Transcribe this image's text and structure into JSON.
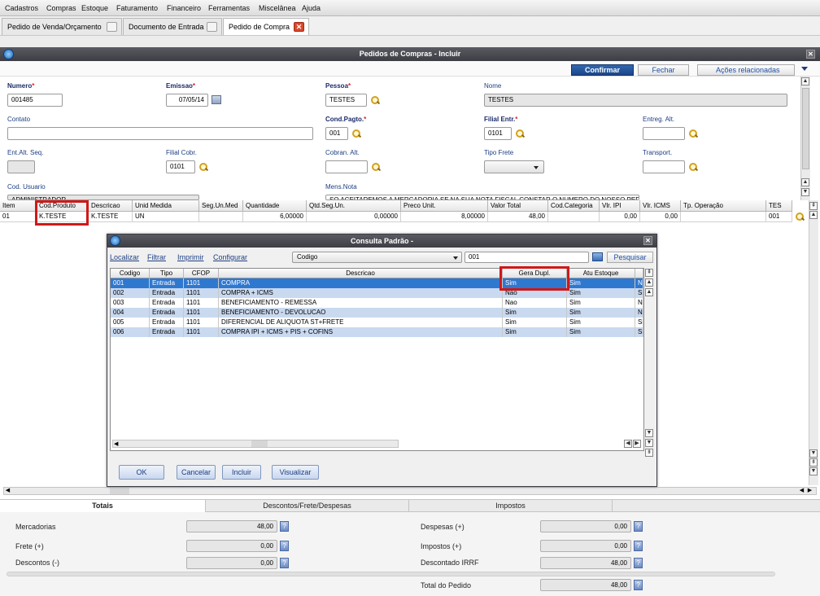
{
  "menu": [
    "Cadastros",
    "Compras",
    "Estoque",
    "Faturamento",
    "Financeiro",
    "Ferramentas",
    "Miscelânea",
    "Ajuda"
  ],
  "tabs": [
    {
      "label": "Pedido de Venda/Orçamento"
    },
    {
      "label": "Documento de Entrada"
    },
    {
      "label": "Pedido de Compra"
    }
  ],
  "window": {
    "title": "Pedidos de Compras - Incluir"
  },
  "toolbar": {
    "confirm": "Confirmar",
    "close": "Fechar",
    "actions": "Ações relacionadas"
  },
  "form": {
    "numero_label": "Numero",
    "numero": "001485",
    "emissao_label": "Emissao",
    "emissao": "07/05/14",
    "pessoa_label": "Pessoa",
    "pessoa": "TESTES",
    "nome_label": "Nome",
    "nome": "TESTES",
    "contato_label": "Contato",
    "contato": "",
    "cond_label": "Cond.Pagto.",
    "cond": "001",
    "filial_entr_label": "Filial Entr.",
    "filial_entr": "0101",
    "entreg_alt_label": "Entreg. Alt.",
    "entreg_alt": "",
    "ent_alt_seq_label": "Ent.Alt. Seq.",
    "ent_alt_seq": "",
    "filial_cobr_label": "Filial Cobr.",
    "filial_cobr": "0101",
    "cobran_alt_label": "Cobran. Alt.",
    "cobran_alt": "",
    "tipo_frete_label": "Tipo Frete",
    "tipo_frete": "",
    "transport_label": "Transport.",
    "transport": "",
    "cod_usuario_label": "Cod. Usuario",
    "cod_usuario": "ADMINISTRADOR",
    "mens_nota_label": "Mens.Nota",
    "mens_nota": "SO ACEITAREMOS A MERCADORIA SE NA SUA NOTA FISCAL CONSTAR O NUMERO DO NOSSO PEDIDO"
  },
  "grid": {
    "headers": [
      "Item",
      "Cod.Produto",
      "Descricao",
      "Unid Medida",
      "Seg.Un.Med",
      "Quantidade",
      "Qtd.Seg.Un.",
      "Preco Unit.",
      "Valor Total",
      "Cod.Categoria",
      "Vlr. IPI",
      "Vlr. ICMS",
      "Tp. Operação",
      "TES"
    ],
    "row": [
      "01",
      "K.TESTE",
      "K.TESTE",
      "UN",
      "",
      "6,00000",
      "0,00000",
      "8,00000",
      "48,00",
      "",
      "0,00",
      "0,00",
      "",
      "001"
    ]
  },
  "dialog": {
    "title": "Consulta Padrão -",
    "links": [
      "Localizar",
      "Filtrar",
      "Imprimir",
      "Configurar"
    ],
    "search_field": "Codigo",
    "search_value": "001",
    "search_button": "Pesquisar",
    "headers": [
      "Codigo",
      "Tipo",
      "CFOP",
      "Descricao",
      "Gera Dupl.",
      "Atu Estoque"
    ],
    "rows": [
      {
        "codigo": "001",
        "tipo": "Entrada",
        "cfop": "1101",
        "descricao": "COMPRA",
        "gera": "Sim",
        "atu": "Sim",
        "extra": "N"
      },
      {
        "codigo": "002",
        "tipo": "Entrada",
        "cfop": "1101",
        "descricao": "COMPRA + ICMS",
        "gera": "Nao",
        "atu": "Sim",
        "extra": "Si"
      },
      {
        "codigo": "003",
        "tipo": "Entrada",
        "cfop": "1101",
        "descricao": "BENEFICIAMENTO - REMESSA",
        "gera": "Nao",
        "atu": "Sim",
        "extra": "N"
      },
      {
        "codigo": "004",
        "tipo": "Entrada",
        "cfop": "1101",
        "descricao": "BENEFICIAMENTO - DEVOLUCAO",
        "gera": "Sim",
        "atu": "Sim",
        "extra": "N"
      },
      {
        "codigo": "005",
        "tipo": "Entrada",
        "cfop": "1101",
        "descricao": "DIFERENCIAL DE ALIQUOTA ST+FRETE",
        "gera": "Sim",
        "atu": "Sim",
        "extra": "Si"
      },
      {
        "codigo": "006",
        "tipo": "Entrada",
        "cfop": "1101",
        "descricao": "COMPRA IPI + ICMS + PIS + COFINS",
        "gera": "Sim",
        "atu": "Sim",
        "extra": "Si"
      }
    ],
    "buttons": {
      "ok": "OK",
      "cancel": "Cancelar",
      "include": "Incluir",
      "view": "Visualizar"
    }
  },
  "bottom_tabs": [
    "Totais",
    "Descontos/Frete/Despesas",
    "Impostos"
  ],
  "totals": {
    "mercadorias_label": "Mercadorias",
    "mercadorias": "48,00",
    "frete_label": "Frete (+)",
    "frete": "0,00",
    "descontos_label": "Descontos (-)",
    "descontos": "0,00",
    "despesas_label": "Despesas (+)",
    "despesas": "0,00",
    "impostos_label": "Impostos (+)",
    "impostos": "0,00",
    "irrf_label": "Descontado IRRF",
    "irrf": "48,00",
    "total_label": "Total do Pedido",
    "total": "48,00"
  },
  "colors": {
    "accent": "#1c4488",
    "selected_row": "#2f78d0",
    "alt_row": "#c9d9ef",
    "highlight": "#d01818"
  }
}
